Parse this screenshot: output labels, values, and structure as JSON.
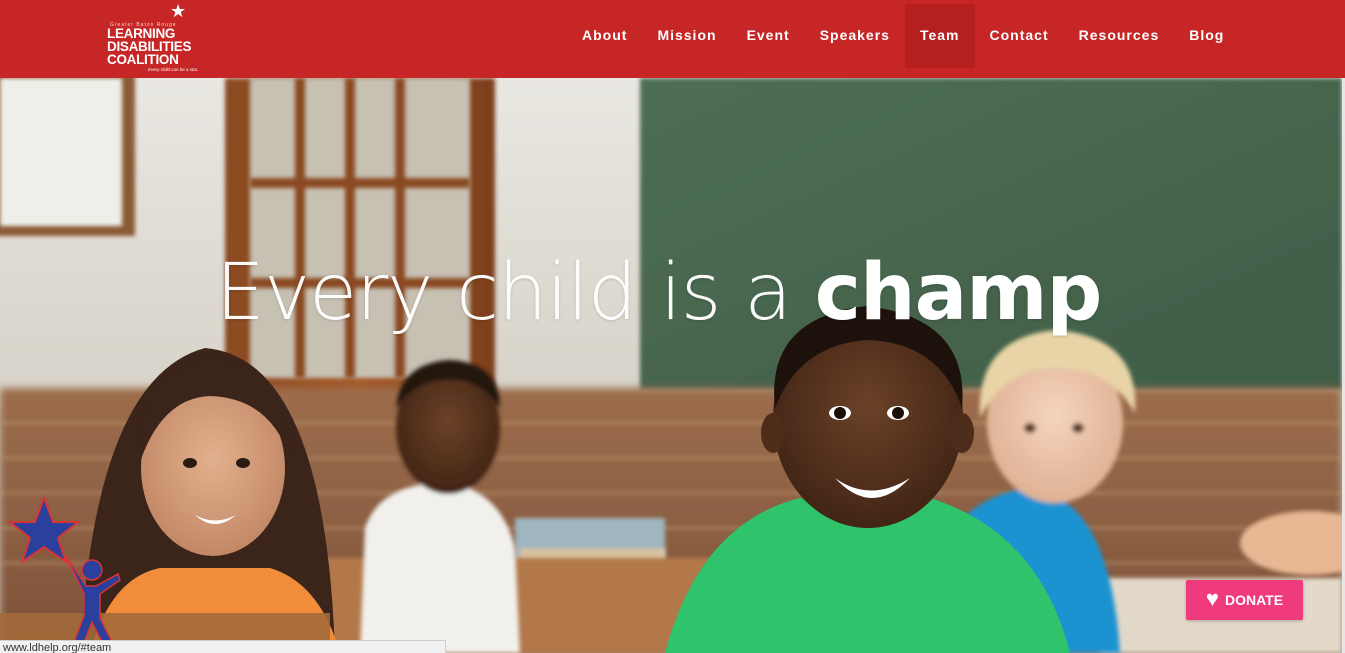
{
  "header": {
    "logo": {
      "top_tiny_text": "Greater Baton Rouge",
      "line1": "LEARNING",
      "line2": "DISABILITIES",
      "line3": "COALITION",
      "tagline": "Every child can be a star."
    },
    "nav": [
      {
        "label": "About",
        "active": false
      },
      {
        "label": "Mission",
        "active": false
      },
      {
        "label": "Event",
        "active": false
      },
      {
        "label": "Speakers",
        "active": false
      },
      {
        "label": "Team",
        "active": true
      },
      {
        "label": "Contact",
        "active": false
      },
      {
        "label": "Resources",
        "active": false
      },
      {
        "label": "Blog",
        "active": false
      }
    ]
  },
  "hero": {
    "headline_light": "Every child is a ",
    "headline_bold": "champ"
  },
  "donate": {
    "label": "DONATE",
    "icon": "heart-icon"
  },
  "status_bar": {
    "url": "www.ldhelp.org/#team"
  },
  "colors": {
    "header_red": "#c62626",
    "active_nav_red": "#b51f1f",
    "donate_pink": "#ef3b7e",
    "mascot_blue": "#2b3f9c"
  }
}
